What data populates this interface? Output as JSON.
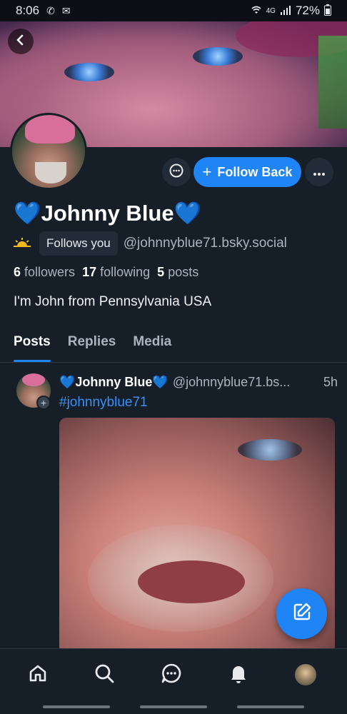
{
  "status_bar": {
    "time": "8:06",
    "battery": "72%",
    "network": "4G"
  },
  "profile": {
    "display_name": "💙Johnny Blue💙",
    "follows_you": "Follows you",
    "handle": "@johnnyblue71.bsky.social",
    "followers_count": "6",
    "followers_label": "followers",
    "following_count": "17",
    "following_label": "following",
    "posts_count": "5",
    "posts_label": "posts",
    "bio": "I'm John from Pennsylvania USA",
    "follow_back_label": "Follow Back"
  },
  "tabs": [
    {
      "label": "Posts",
      "active": true
    },
    {
      "label": "Replies",
      "active": false
    },
    {
      "label": "Media",
      "active": false
    }
  ],
  "post": {
    "author_name": "💙Johnny Blue💙",
    "author_handle": "@johnnyblue71.bs...",
    "time": "5h",
    "text": "#johnnyblue71"
  },
  "icons": {
    "back": "chevron-left-icon",
    "message": "chat-bubble-icon",
    "more": "ellipsis-icon",
    "compose": "compose-icon",
    "home": "home-icon",
    "search": "search-icon",
    "chat": "chat-icon",
    "notifications": "bell-icon"
  },
  "colors": {
    "accent": "#1f84f5",
    "background": "#161e27",
    "muted_text": "#aab4c0"
  }
}
